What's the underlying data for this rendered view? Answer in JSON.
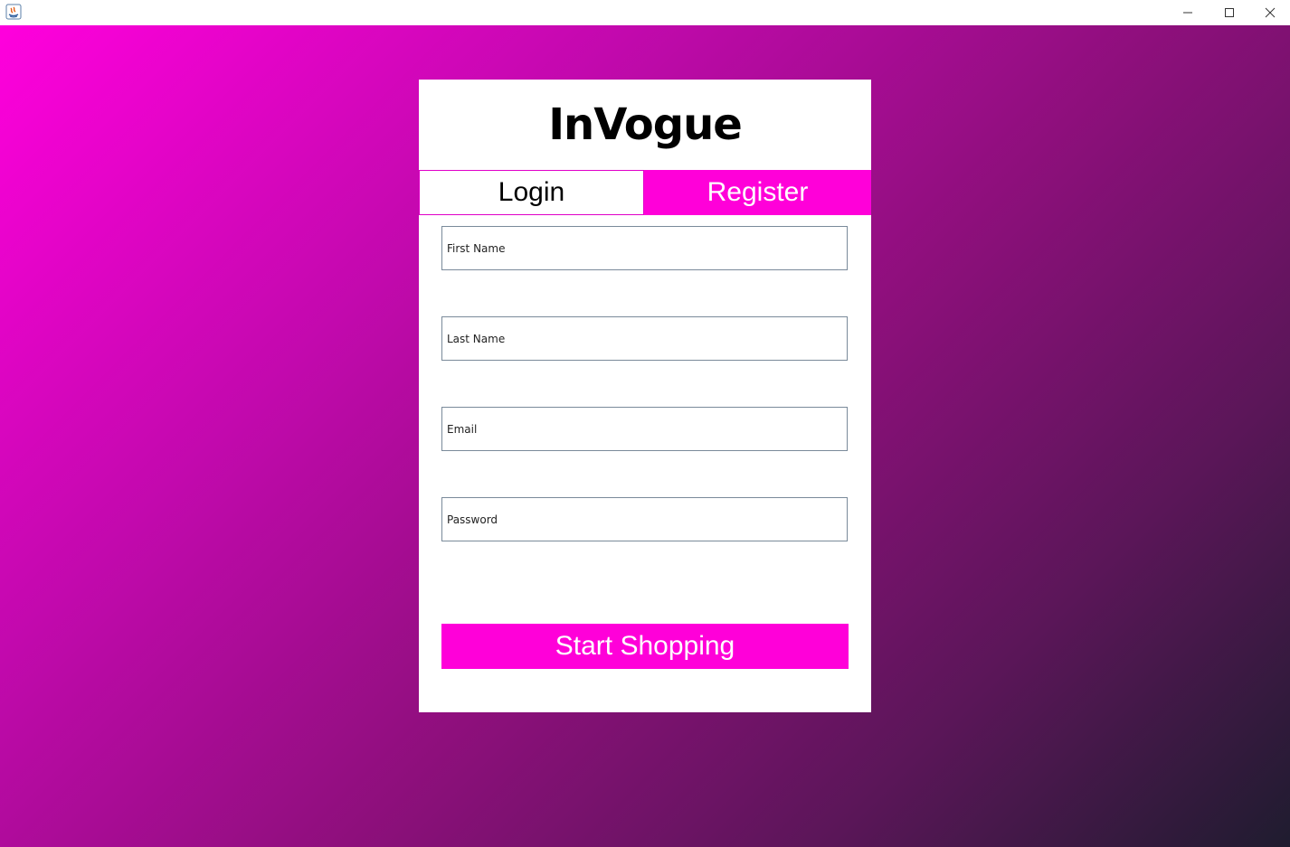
{
  "window": {
    "icons": {
      "app": "java-app-icon",
      "minimize": "minimize-icon",
      "maximize": "maximize-icon",
      "close": "close-icon"
    }
  },
  "brand": {
    "title": "InVogue"
  },
  "tabs": [
    {
      "label": "Login",
      "active": false
    },
    {
      "label": "Register",
      "active": true
    }
  ],
  "form": {
    "first_name_placeholder": "First Name",
    "last_name_placeholder": "Last Name",
    "email_placeholder": "Email",
    "password_placeholder": "Password",
    "submit_label": "Start Shopping"
  },
  "colors": {
    "accent": "#ff00d9",
    "gradient_start": "#ff00dd",
    "gradient_end": "#1f1c2f",
    "card_background": "#ffffff"
  }
}
